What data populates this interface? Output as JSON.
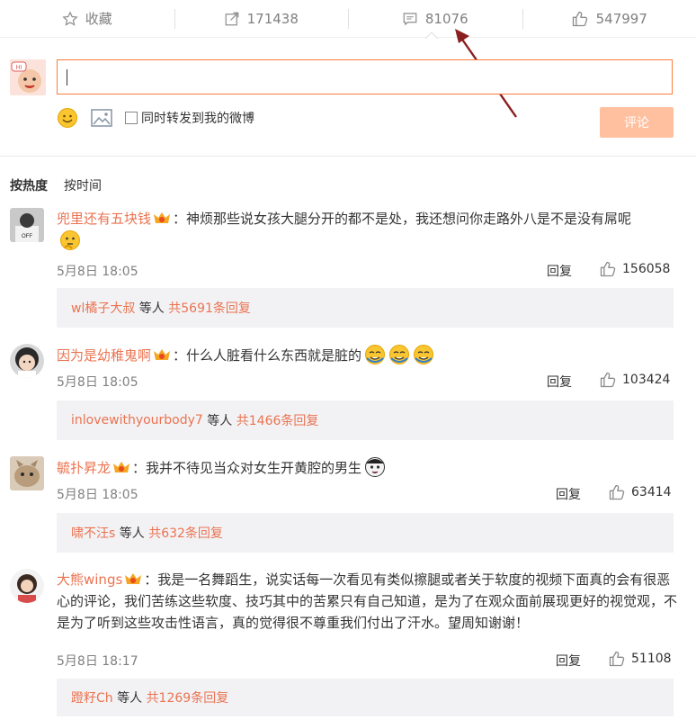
{
  "actions": {
    "favorite_label": "收藏",
    "repost_count": "171438",
    "comment_count": "81076",
    "like_count": "547997"
  },
  "composer": {
    "sync_label": "同时转发到我的微博",
    "submit_label": "评论"
  },
  "sort": {
    "hot_label": "按热度",
    "time_label": "按时间"
  },
  "colors": {
    "accent": "#eb7350",
    "submit_bg": "#ffc09f",
    "input_border": "#fa7d3c",
    "reply_bg": "#f2f2f5"
  },
  "comments": [
    {
      "user": "兜里还有五块钱",
      "text": "：神烦那些说女孩大腿分开的都不是处，我还想问你走路外八是不是没有屌呢",
      "time": "5月8日 18:05",
      "reply_label": "回复",
      "likes": "156058",
      "sub_user": "wl橘子大叔",
      "sub_mid": " 等人 ",
      "sub_count": "共5691条回复"
    },
    {
      "user": "因为是幼稚鬼啊",
      "text": "：什么人脏看什么东西就是脏的",
      "time": "5月8日 18:05",
      "reply_label": "回复",
      "likes": "103424",
      "sub_user": "inlovewithyourbody7",
      "sub_mid": " 等人 ",
      "sub_count": "共1466条回复"
    },
    {
      "user": "毓扑昇龙",
      "text": "：我并不待见当众对女生开黄腔的男生",
      "time": "5月8日 18:05",
      "reply_label": "回复",
      "likes": "63414",
      "sub_user": "啸不汪s",
      "sub_mid": " 等人 ",
      "sub_count": "共632条回复"
    },
    {
      "user": "大熊wings",
      "text": "：我是一名舞蹈生，说实话每一次看见有类似擦腿或者关于软度的视频下面真的会有很恶心的评论，我们苦练这些软度、技巧其中的苦累只有自己知道，是为了在观众面前展现更好的视觉观，不是为了听到这些攻击性语言，真的觉得很不尊重我们付出了汗水。望周知谢谢！",
      "time": "5月8日 18:17",
      "reply_label": "回复",
      "likes": "51108",
      "sub_user": "蹬籽Ch",
      "sub_mid": " 等人 ",
      "sub_count": "共1269条回复"
    }
  ]
}
